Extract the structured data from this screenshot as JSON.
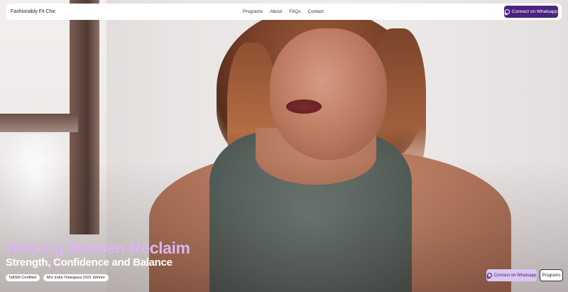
{
  "nav": {
    "brand": "Fashionably Fit Chic",
    "links": [
      "Programs",
      "About",
      "FAQs",
      "Contact"
    ],
    "cta": {
      "label": "Connect on Whatsapp",
      "icon": "whatsapp-icon"
    }
  },
  "hero": {
    "headline": "Helping Women Reclaim",
    "subheadline": "Strength, Confidence and Balance",
    "badges": [
      "NASM Certified",
      "Mrs India Telangana 2021 Winner"
    ],
    "cta_whatsapp": {
      "label": "Connect on Whatsapp",
      "icon": "whatsapp-icon"
    },
    "cta_programs": "Programs"
  },
  "colors": {
    "accent": "#4a2280",
    "headline": "#d9b6f0",
    "cta_light": "#dcc6f3"
  }
}
